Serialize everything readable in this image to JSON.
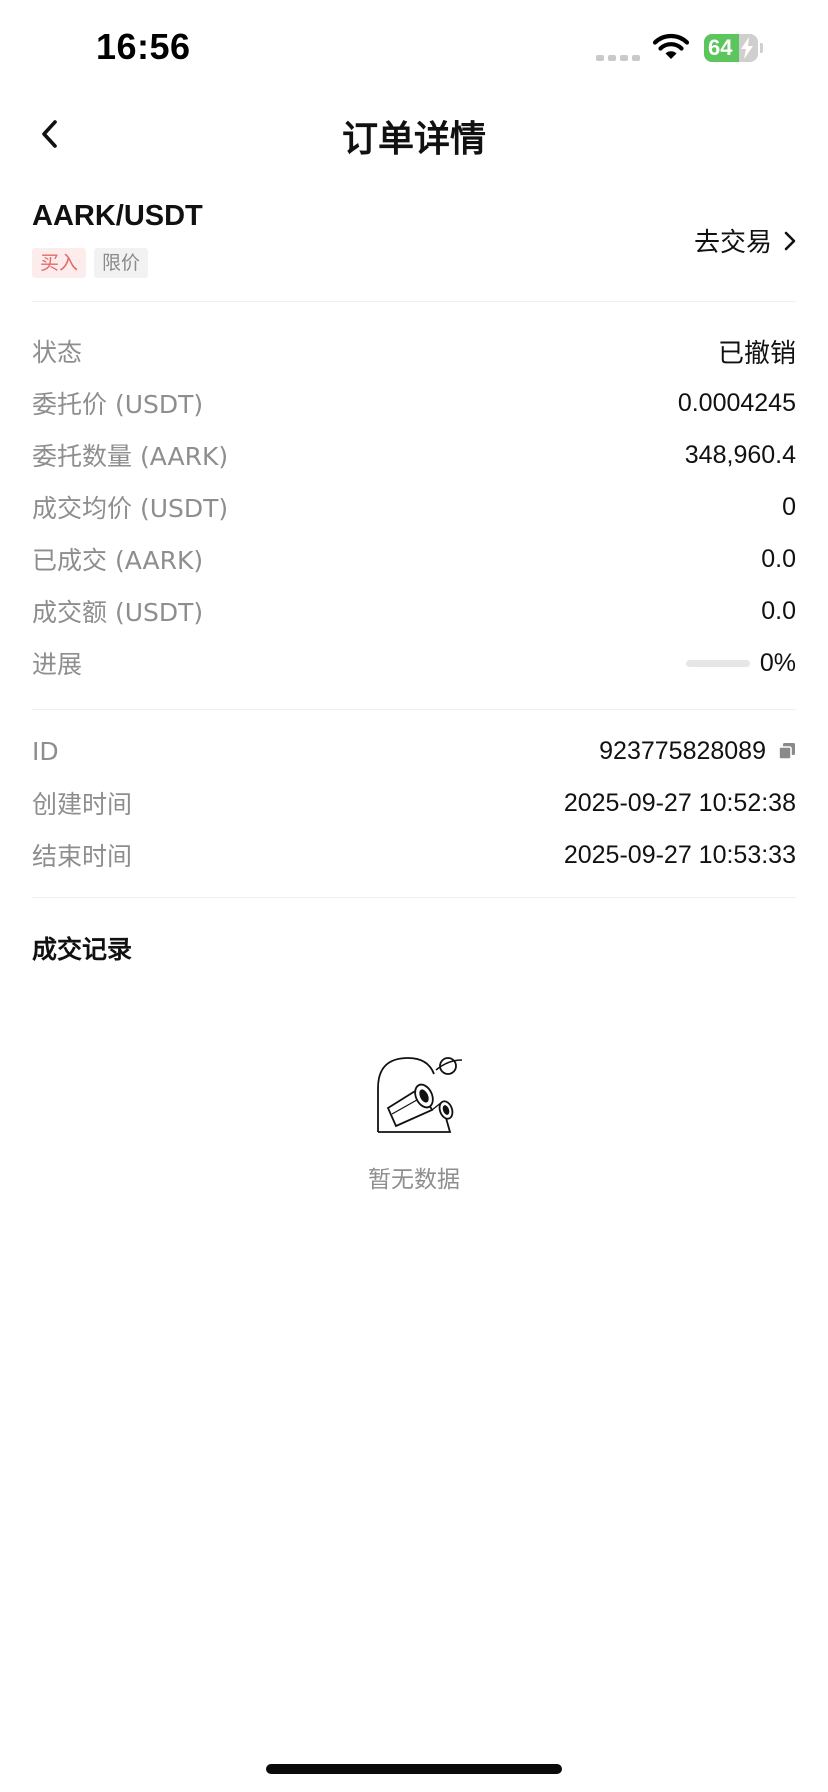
{
  "status_bar": {
    "time": "16:56",
    "battery_level": "64",
    "battery_percent": 64,
    "icons": [
      "signal-icon",
      "wifi-icon",
      "battery-charging-icon"
    ]
  },
  "nav": {
    "title": "订单详情",
    "back_icon": "chevron-left-icon"
  },
  "order": {
    "pair": "AARK/USDT",
    "side_tag": "买入",
    "type_tag": "限价",
    "trade_link": "去交易"
  },
  "details": [
    {
      "label": "状态",
      "value": "已撤销"
    },
    {
      "label": "委托价 (USDT)",
      "value": "0.0004245"
    },
    {
      "label": "委托数量 (AARK)",
      "value": "348,960.4"
    },
    {
      "label": "成交均价 (USDT)",
      "value": "0"
    },
    {
      "label": "已成交 (AARK)",
      "value": "0.0"
    },
    {
      "label": "成交额 (USDT)",
      "value": "0.0"
    },
    {
      "label": "进展",
      "value": "0%",
      "progress": 0
    }
  ],
  "meta": [
    {
      "label": "ID",
      "value": "923775828089"
    },
    {
      "label": "创建时间",
      "value": "2025-09-27 10:52:38"
    },
    {
      "label": "结束时间",
      "value": "2025-09-27 10:53:33"
    }
  ],
  "records": {
    "title": "成交记录",
    "empty_text": "暂无数据",
    "empty_icon": "telescope-empty-icon"
  },
  "colors": {
    "buy_tag_text": "#e26a6a",
    "buy_tag_bg": "#fcecec",
    "label_gray": "#8e8e8e",
    "battery_green": "#5cc65c"
  }
}
